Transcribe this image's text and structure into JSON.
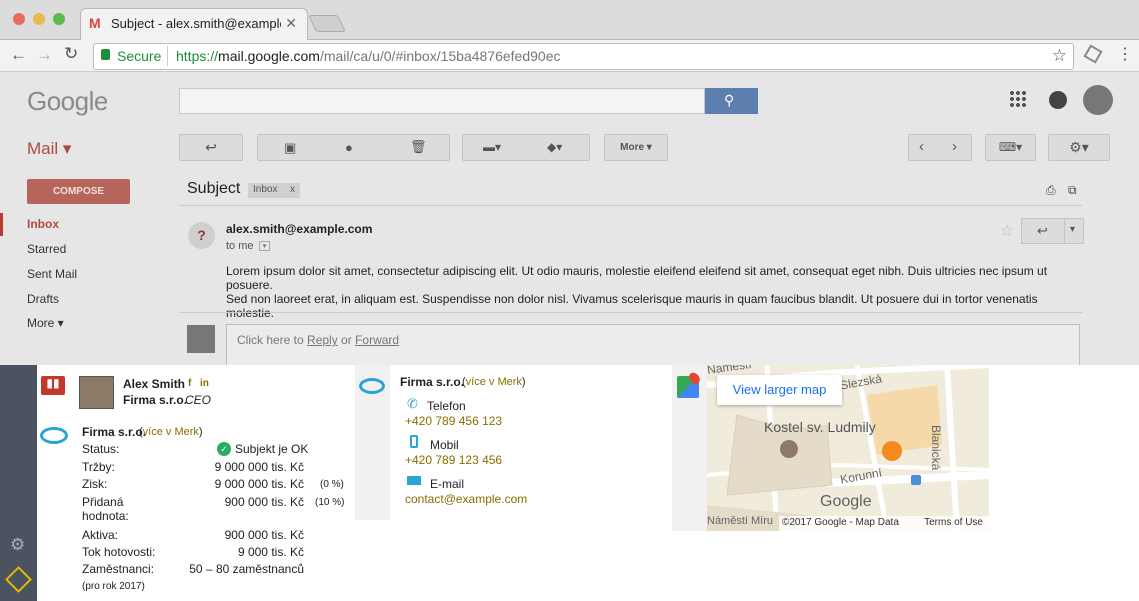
{
  "browser": {
    "tab_title": "Subject - alex.smith@example.com",
    "secure_label": "Secure",
    "url_prefix": "https://",
    "url_host": "mail.google.com",
    "url_path": "/mail/ca/u/0/#inbox/15ba4876efed90ec"
  },
  "gmail": {
    "logo": "Google",
    "mail_label": "Mail ▾",
    "compose": "COMPOSE",
    "more_btn": "More ▾",
    "nav": [
      "Inbox",
      "Starred",
      "Sent Mail",
      "Drafts",
      "More ▾"
    ],
    "subject": "Subject",
    "chip": "Inbox",
    "chip_x": "x",
    "sender": "alex.smith@example.com",
    "to_me": "to me",
    "body1": "Lorem ipsum dolor sit amet, consectetur adipiscing elit. Ut odio mauris, molestie eleifend eleifend sit amet, consequat eget nibh. Duis ultricies nec ipsum ut posuere.",
    "body2": "Sed non laoreet erat, in aliquam est. Suspendisse non dolor nisl. Vivamus scelerisque mauris in quam faucibus blandit. Ut posuere dui in tortor venenatis molestie.",
    "reply_pre": "Click here to ",
    "reply": "Reply",
    "or": " or ",
    "forward": "Forward"
  },
  "contact": {
    "name": "Alex Smith",
    "fb": "f",
    "li": "in",
    "company": "Firma s.r.o.",
    "role": "CEO"
  },
  "company": {
    "name": "Firma s.r.o.",
    "more_open": " (",
    "more": "více v Merk",
    "more_close": ")",
    "rows": [
      {
        "label": "Status:",
        "value": "Subjekt je OK",
        "pct": ""
      },
      {
        "label": "Tržby:",
        "value": "9 000 000 tis. Kč",
        "pct": ""
      },
      {
        "label": "Zisk:",
        "value": "9 000 000 tis. Kč",
        "pct": "(0 %)"
      },
      {
        "label": "Přidaná hodnota:",
        "value": "900 000 tis. Kč",
        "pct": "(10 %)"
      },
      {
        "label": "Aktiva:",
        "value": "900 000 tis. Kč",
        "pct": ""
      },
      {
        "label": "Tok hotovosti:",
        "value": "9 000 tis. Kč",
        "pct": ""
      },
      {
        "label": "Zaměstnanci:",
        "value": "50 – 80 zaměstnanců",
        "pct": ""
      }
    ],
    "footnote": "(pro rok 2017)"
  },
  "contacts2": {
    "name": "Firma s.r.o.",
    "more": "více v Merk",
    "phone_label": "Telefon",
    "phone": "+420 789 456 123",
    "mobile_label": "Mobil",
    "mobile": "+420 789 123 456",
    "email_label": "E-mail",
    "email": "contact@example.com"
  },
  "map": {
    "larger": "View larger map",
    "poi": "Kostel sv. Ludmily",
    "streets": [
      "Náměstí",
      "Slezská",
      "Blanická",
      "Korunní",
      "Náměstí Míru"
    ],
    "logo": "Google",
    "copyright": "©2017 Google - Map Data",
    "terms": "Terms of Use"
  },
  "colors": {
    "accent": "#8a6d00",
    "compose": "#b5655a",
    "inbox_red": "#c0392b",
    "merk_blue": "#2aa4d5"
  }
}
